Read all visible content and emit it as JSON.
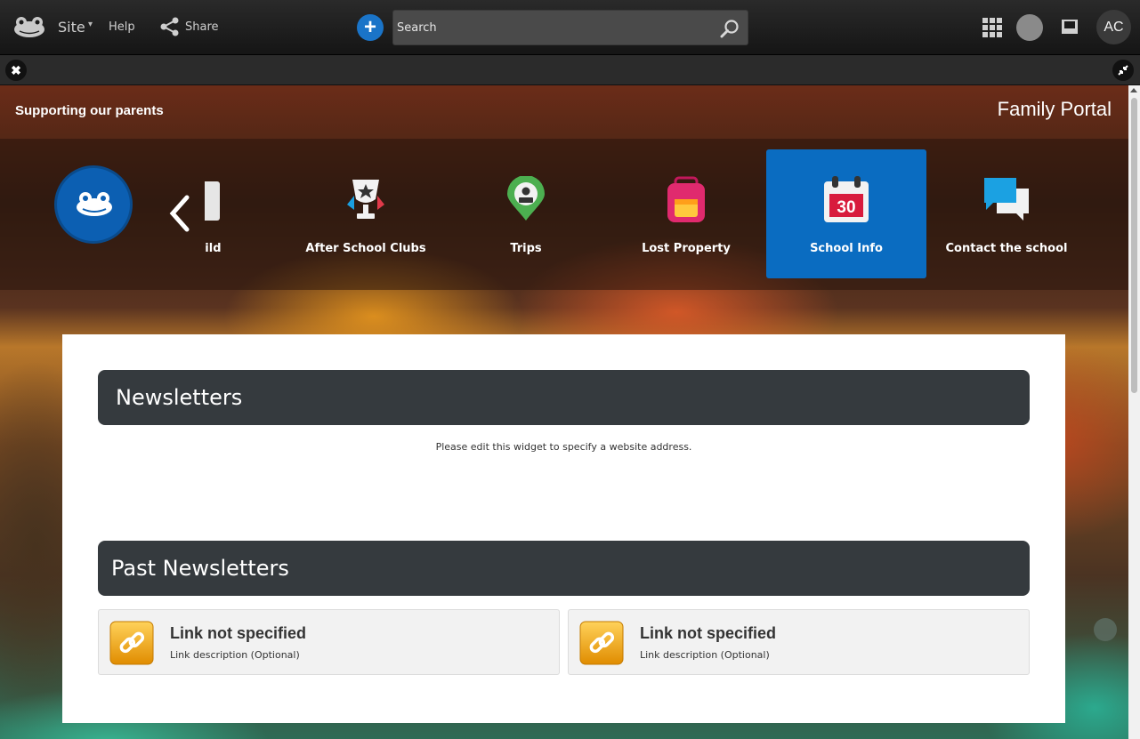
{
  "topbar": {
    "site_label": "Site",
    "site_caret": "▾",
    "help_label": "Help",
    "share_label": "Share",
    "add_symbol": "+",
    "search_placeholder": "Search",
    "avatar_initials": "AC"
  },
  "subbar": {
    "close_symbol": "✖"
  },
  "page": {
    "tagline": "Supporting our parents",
    "title": "Family Portal"
  },
  "nav": {
    "items": [
      {
        "label": "Child",
        "icon": "id-card-icon"
      },
      {
        "label": "After School Clubs",
        "icon": "trophy-icon"
      },
      {
        "label": "Trips",
        "icon": "map-pin-icon"
      },
      {
        "label": "Lost Property",
        "icon": "backpack-icon"
      },
      {
        "label": "School Info",
        "icon": "calendar-icon",
        "active": true,
        "calendar_day": "30"
      },
      {
        "label": "Contact the school",
        "icon": "chat-bubbles-icon"
      }
    ]
  },
  "newsletters": {
    "heading": "Newsletters",
    "note": "Please edit this widget to specify a website address."
  },
  "past_newsletters": {
    "heading": "Past Newsletters",
    "links": [
      {
        "title": "Link not specified",
        "description": "Link description (Optional)"
      },
      {
        "title": "Link not specified",
        "description": "Link description (Optional)"
      }
    ]
  },
  "colors": {
    "accent_blue": "#0a6cc1",
    "header_dark": "#353a3e",
    "link_icon_orange": "#f0a51b"
  }
}
